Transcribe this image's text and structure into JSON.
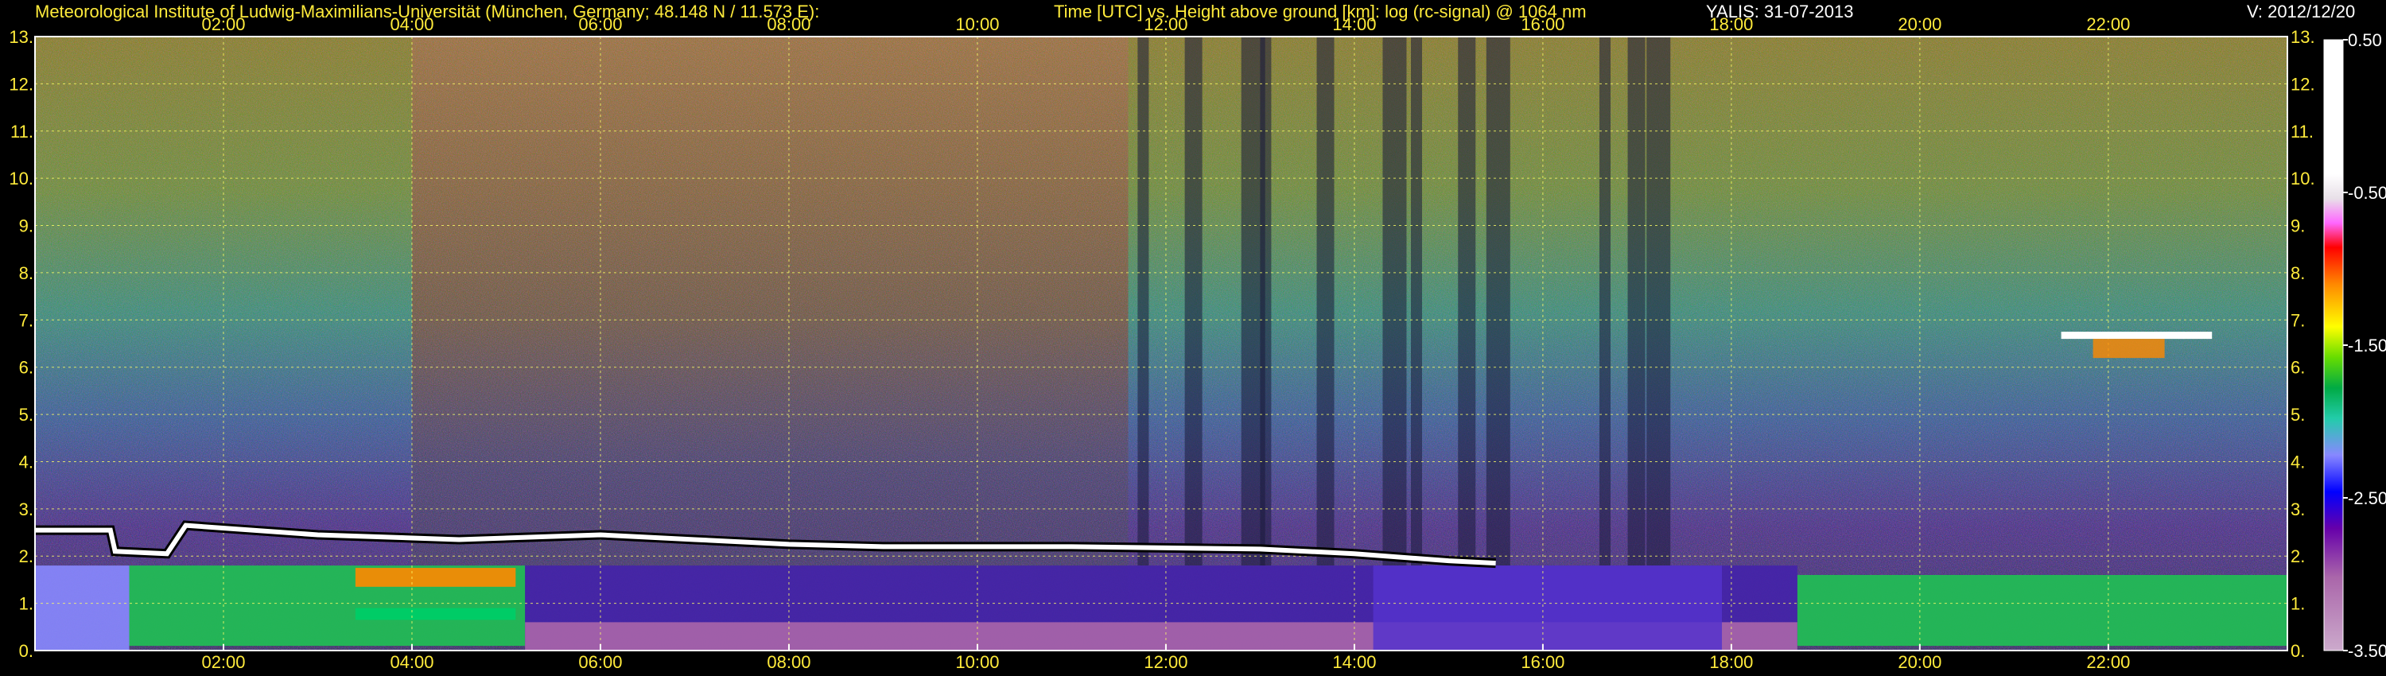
{
  "header": {
    "institute": "Meteorological Institute of Ludwig-Maximilians-Universität (München, Germany; 48.148 N / 11.573 E):",
    "axes_desc": "Time [UTC] vs. Height above ground [km]: log (rc-signal) @ 1064 nm",
    "instrument": "YALIS: 31-07-2013",
    "version": "V: 2012/12/20"
  },
  "chart_data": {
    "type": "heatmap",
    "title": "Time [UTC] vs. Height above ground [km]: log (rc-signal) @ 1064 nm",
    "x_ticks": [
      "02:00",
      "04:00",
      "06:00",
      "08:00",
      "10:00",
      "12:00",
      "14:00",
      "16:00",
      "18:00",
      "20:00",
      "22:00"
    ],
    "x_tick_hours": [
      2,
      4,
      6,
      8,
      10,
      12,
      14,
      16,
      18,
      20,
      22
    ],
    "xlim_hours": [
      0,
      23.9
    ],
    "y_ticks": [
      "0.",
      "1.",
      "2.",
      "3.",
      "4.",
      "5.",
      "6.",
      "7.",
      "8.",
      "9.",
      "10.",
      "11.",
      "12.",
      "13."
    ],
    "ylim_km": [
      0,
      13
    ],
    "colorbar": {
      "ticks": [
        "0.50",
        "-0.50",
        "-1.50",
        "-2.50",
        "-3.50"
      ],
      "range": [
        -3.5,
        0.5
      ],
      "colors": [
        "#ffffff",
        "#e8e0e8",
        "#ff66ff",
        "#ff0000",
        "#ff8800",
        "#ffff00",
        "#66dd00",
        "#00aa44",
        "#22ccaa",
        "#8888ff",
        "#0000ff",
        "#6600aa",
        "#aa66aa",
        "#ccaacc"
      ]
    },
    "features": {
      "aerosol_layer_top_km": [
        {
          "t": 0.0,
          "h": 2.55
        },
        {
          "t": 0.8,
          "h": 2.55
        },
        {
          "t": 0.85,
          "h": 2.1
        },
        {
          "t": 1.4,
          "h": 2.05
        },
        {
          "t": 1.6,
          "h": 2.65
        },
        {
          "t": 3.0,
          "h": 2.45
        },
        {
          "t": 4.5,
          "h": 2.35
        },
        {
          "t": 6.0,
          "h": 2.45
        },
        {
          "t": 7.0,
          "h": 2.35
        },
        {
          "t": 8.0,
          "h": 2.25
        },
        {
          "t": 9.0,
          "h": 2.2
        },
        {
          "t": 11.0,
          "h": 2.2
        },
        {
          "t": 13.0,
          "h": 2.15
        },
        {
          "t": 14.0,
          "h": 2.05
        },
        {
          "t": 15.0,
          "h": 1.9
        },
        {
          "t": 15.5,
          "h": 1.85
        }
      ],
      "cloud_layer": {
        "t_start": 21.5,
        "t_end": 23.1,
        "h": 6.7
      },
      "green_boundary_layer": [
        {
          "t_start": 1.0,
          "t_end": 5.2,
          "top_km": 1.8
        },
        {
          "t_start": 18.7,
          "t_end": 23.9,
          "top_km": 1.6
        }
      ]
    }
  }
}
